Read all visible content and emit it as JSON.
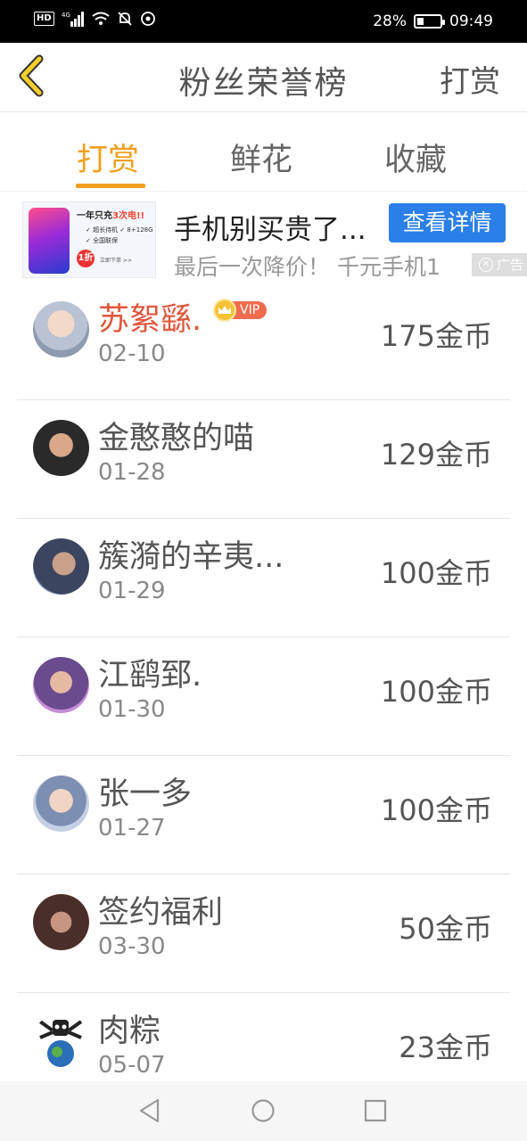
{
  "status_bar": {
    "network": "HD",
    "signal": "4G",
    "battery": "28%",
    "battery_level": 0.28,
    "time": "09:49"
  },
  "header": {
    "title": "粉丝荣誉榜",
    "action": "打赏",
    "back_icon": "chevron-left-icon"
  },
  "tabs": [
    {
      "label": "打赏",
      "active": true
    },
    {
      "label": "鲜花",
      "active": false
    },
    {
      "label": "收藏",
      "active": false
    }
  ],
  "ad": {
    "image_headline_prefix": "一年只充",
    "image_headline_highlight": "3次电!!",
    "image_features": [
      "超长待机",
      "8+128G",
      "全国联保"
    ],
    "image_badge": "1折",
    "image_cta": "立即下单 >>",
    "title": "手机别买贵了...",
    "button": "查看详情",
    "subtitle": "最后一次降价！ 千元手机1",
    "tag": "广告"
  },
  "list": [
    {
      "name": "苏絮繇.",
      "vip": true,
      "vip_label": "VIP",
      "date": "02-10",
      "amount": "175金币"
    },
    {
      "name": "金憨憨的喵",
      "vip": false,
      "date": "01-28",
      "amount": "129金币"
    },
    {
      "name": "簇漪的辛夷...",
      "vip": false,
      "date": "01-29",
      "amount": "100金币"
    },
    {
      "name": "江鹞郅.",
      "vip": false,
      "date": "01-30",
      "amount": "100金币"
    },
    {
      "name": "张一多",
      "vip": false,
      "date": "01-27",
      "amount": "100金币"
    },
    {
      "name": "签约福利",
      "vip": false,
      "date": "03-30",
      "amount": "50金币"
    },
    {
      "name": "肉粽",
      "vip": false,
      "date": "05-07",
      "amount": "23金币"
    }
  ],
  "colors": {
    "accent": "#f0a020",
    "vip_name": "#e0553b",
    "ad_button": "#2a7fe8"
  }
}
